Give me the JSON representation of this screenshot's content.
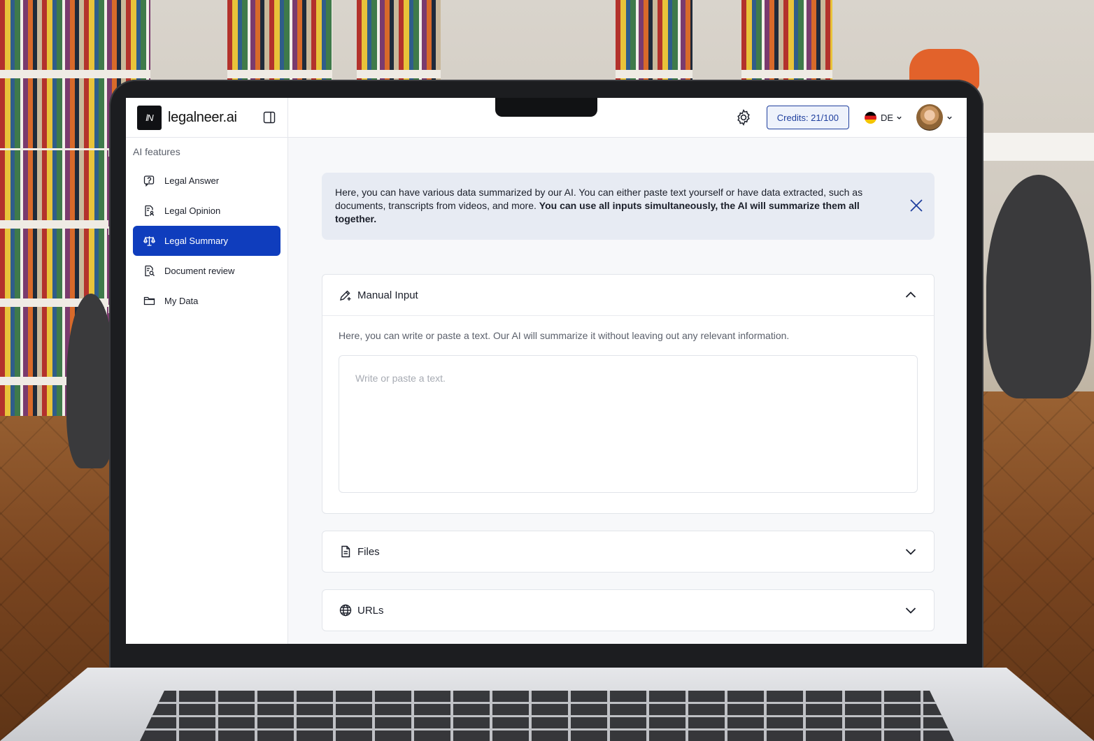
{
  "brand": {
    "logo_text": "lN",
    "name": "legalneer.ai"
  },
  "sidebar": {
    "section_label": "AI features",
    "items": [
      {
        "label": "Legal Answer",
        "icon": "question-doc-icon",
        "active": false
      },
      {
        "label": "Legal Opinion",
        "icon": "document-person-icon",
        "active": false
      },
      {
        "label": "Legal Summary",
        "icon": "scales-icon",
        "active": true
      },
      {
        "label": "Document review",
        "icon": "document-search-icon",
        "active": false
      },
      {
        "label": "My Data",
        "icon": "folder-icon",
        "active": false
      }
    ]
  },
  "topbar": {
    "credits_label": "Credits: 21/100",
    "language": "DE"
  },
  "info": {
    "text": "Here, you can have various data summarized by our AI. You can either paste text yourself or have data extracted, such as documents, transcripts from videos, and more. ",
    "bold_text": "You can use all inputs simultaneously, the AI will summarize them all together."
  },
  "manual_input": {
    "title": "Manual Input",
    "description": "Here, you can write or paste a text. Our AI will summarize it without leaving out any relevant information.",
    "placeholder": "Write or paste a text.",
    "value": ""
  },
  "files": {
    "title": "Files"
  },
  "urls": {
    "title": "URLs"
  },
  "colors": {
    "accent": "#0f3dbd",
    "info_bg": "#e7ebf3",
    "credits_border": "#1f3f9e"
  }
}
